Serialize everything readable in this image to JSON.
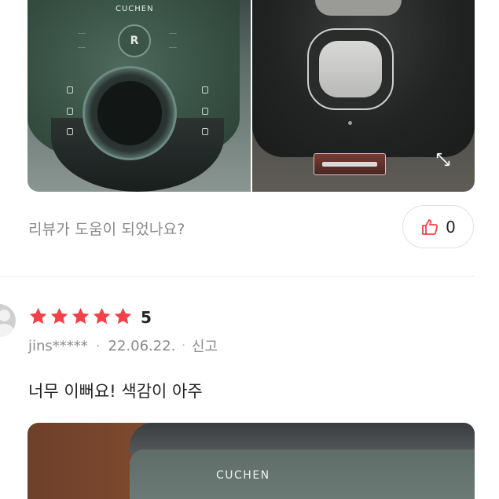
{
  "photos": {
    "top_left_brand": "CUCHEN",
    "top_left_button": "R",
    "bottom_brand": "CUCHEN"
  },
  "helpful": {
    "question": "리뷰가 도움이 되었나요?",
    "like_count": "0"
  },
  "review": {
    "rating": 5,
    "rating_label": "5",
    "author": "jins*****",
    "date": "22.06.22.",
    "report_label": "신고",
    "text": "너무 이뻐요! 색감이 아주"
  },
  "colors": {
    "star": "#f24147",
    "thumb": "#f24147"
  }
}
